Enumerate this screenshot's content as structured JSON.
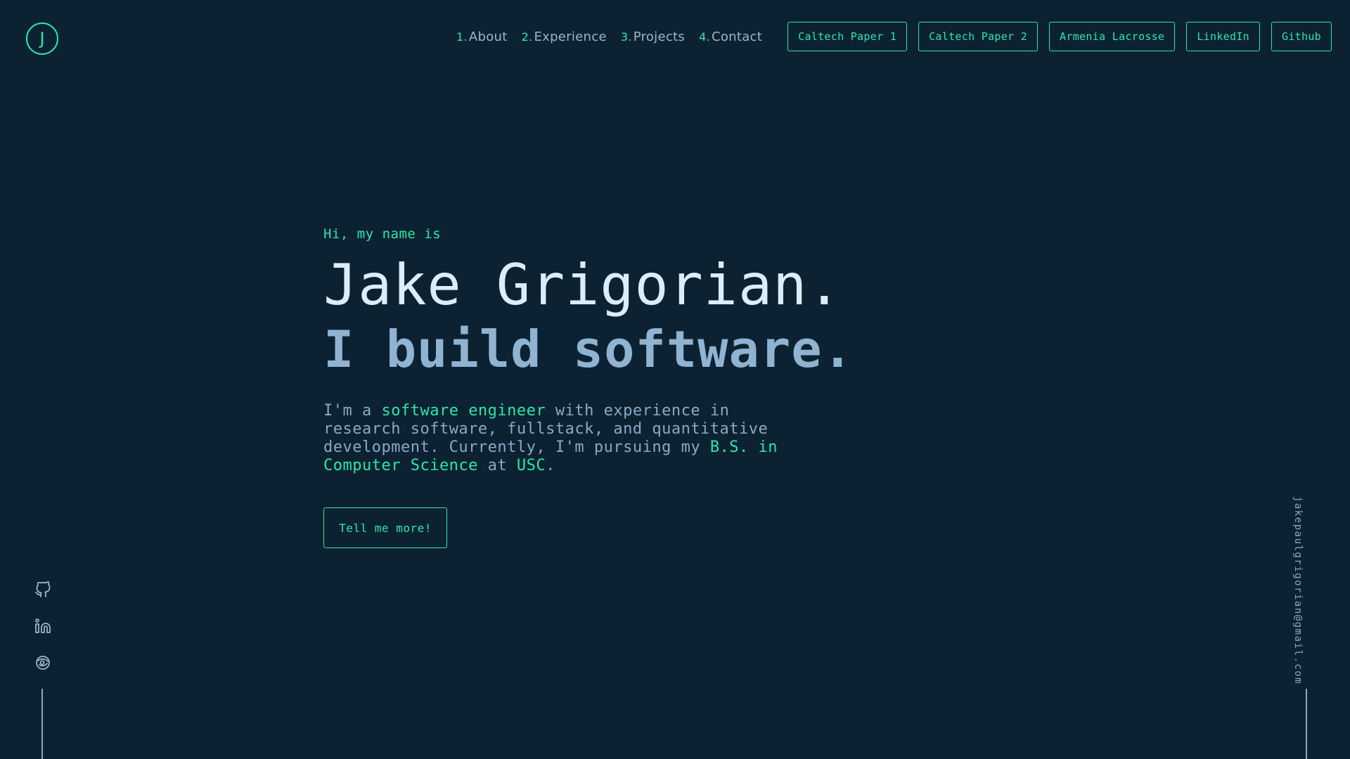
{
  "logo": {
    "letter": "J"
  },
  "nav": {
    "links": [
      {
        "num": "1.",
        "label": "About"
      },
      {
        "num": "2.",
        "label": "Experience"
      },
      {
        "num": "3.",
        "label": "Projects"
      },
      {
        "num": "4.",
        "label": "Contact"
      }
    ],
    "buttons": [
      "Caltech Paper 1",
      "Caltech Paper 2",
      "Armenia Lacrosse",
      "LinkedIn",
      "Github"
    ]
  },
  "hero": {
    "greeting": "Hi, my name is",
    "name": "Jake Grigorian.",
    "tagline": "I build software.",
    "intro": {
      "p1": "I'm a ",
      "h1": "software engineer",
      "p2": " with experience in research software, fullstack, and quantitative development. Currently, I'm pursuing my ",
      "h2": "B.S. in Computer Science",
      "p3": " at ",
      "h3": "USC",
      "p4": "."
    },
    "cta": "Tell me more!"
  },
  "sidebar": {
    "icons": [
      "github-icon",
      "linkedin-icon",
      "lacrosse-icon"
    ],
    "email": "jakepaulgrigorian@gmail.com"
  },
  "colors": {
    "background": "#0c2232",
    "accent": "#2ee6a8",
    "heading": "#dcecf8",
    "text": "#8aa9c5"
  }
}
